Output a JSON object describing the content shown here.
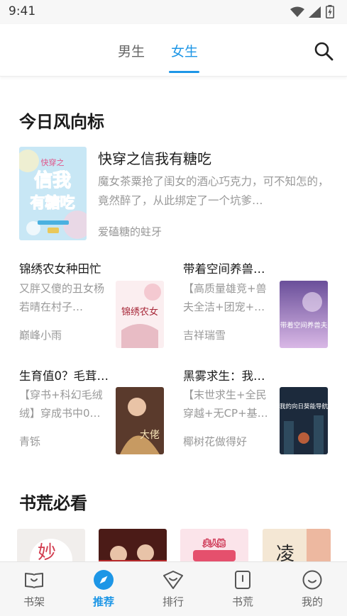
{
  "status_bar": {
    "time": "9:41",
    "icons": [
      "wifi-icon",
      "signal-icon",
      "battery-icon"
    ]
  },
  "top_tabs": [
    {
      "label": "男生",
      "active": false
    },
    {
      "label": "女生",
      "active": true
    }
  ],
  "colors": {
    "accent": "#1d96e6",
    "muted_text": "#999999",
    "title_text": "#1b1b1b"
  },
  "today_trend": {
    "title": "今日风向标",
    "featured": {
      "title": "快穿之信我有糖吃",
      "description": "魔女茶粟抢了闺女的酒心巧克力，可不知怎的，竟然醉了，从此绑定了一个坑爹…",
      "author": "爱磕糖的蛀牙",
      "cover_text": [
        "快穿之",
        "信我",
        "有糖吃"
      ]
    },
    "books": [
      {
        "title": "锦绣农女种田忙",
        "description": "又胖又傻的丑女杨若晴在村子…",
        "author": "巅峰小雨",
        "cover_text": "锦绣农女"
      },
      {
        "title": "带着空间养兽…",
        "description": "【高质量雄竞+兽夫全洁+团宠+…",
        "author": "吉祥瑞雪",
        "cover_text": "带着空间养兽夫"
      },
      {
        "title": "生育值0？毛茸…",
        "description": "【穿书+科幻毛绒绒】穿成书中0…",
        "author": "青铄",
        "cover_text": "大佬"
      },
      {
        "title": "黑雾求生：我…",
        "description": "【末世求生+全民穿越+无CP+基…",
        "author": "椰树花做得好",
        "cover_text": "我的向日葵能导航"
      }
    ]
  },
  "must_read": {
    "title": "书荒必看",
    "covers": [
      "妙",
      "",
      "夫人她",
      "凌"
    ]
  },
  "bottom_nav": [
    {
      "label": "书架",
      "icon": "bookshelf-icon",
      "active": false
    },
    {
      "label": "推荐",
      "icon": "compass-icon",
      "active": true
    },
    {
      "label": "排行",
      "icon": "ranking-icon",
      "active": false
    },
    {
      "label": "书荒",
      "icon": "book-icon",
      "active": false
    },
    {
      "label": "我的",
      "icon": "profile-icon",
      "active": false
    }
  ]
}
